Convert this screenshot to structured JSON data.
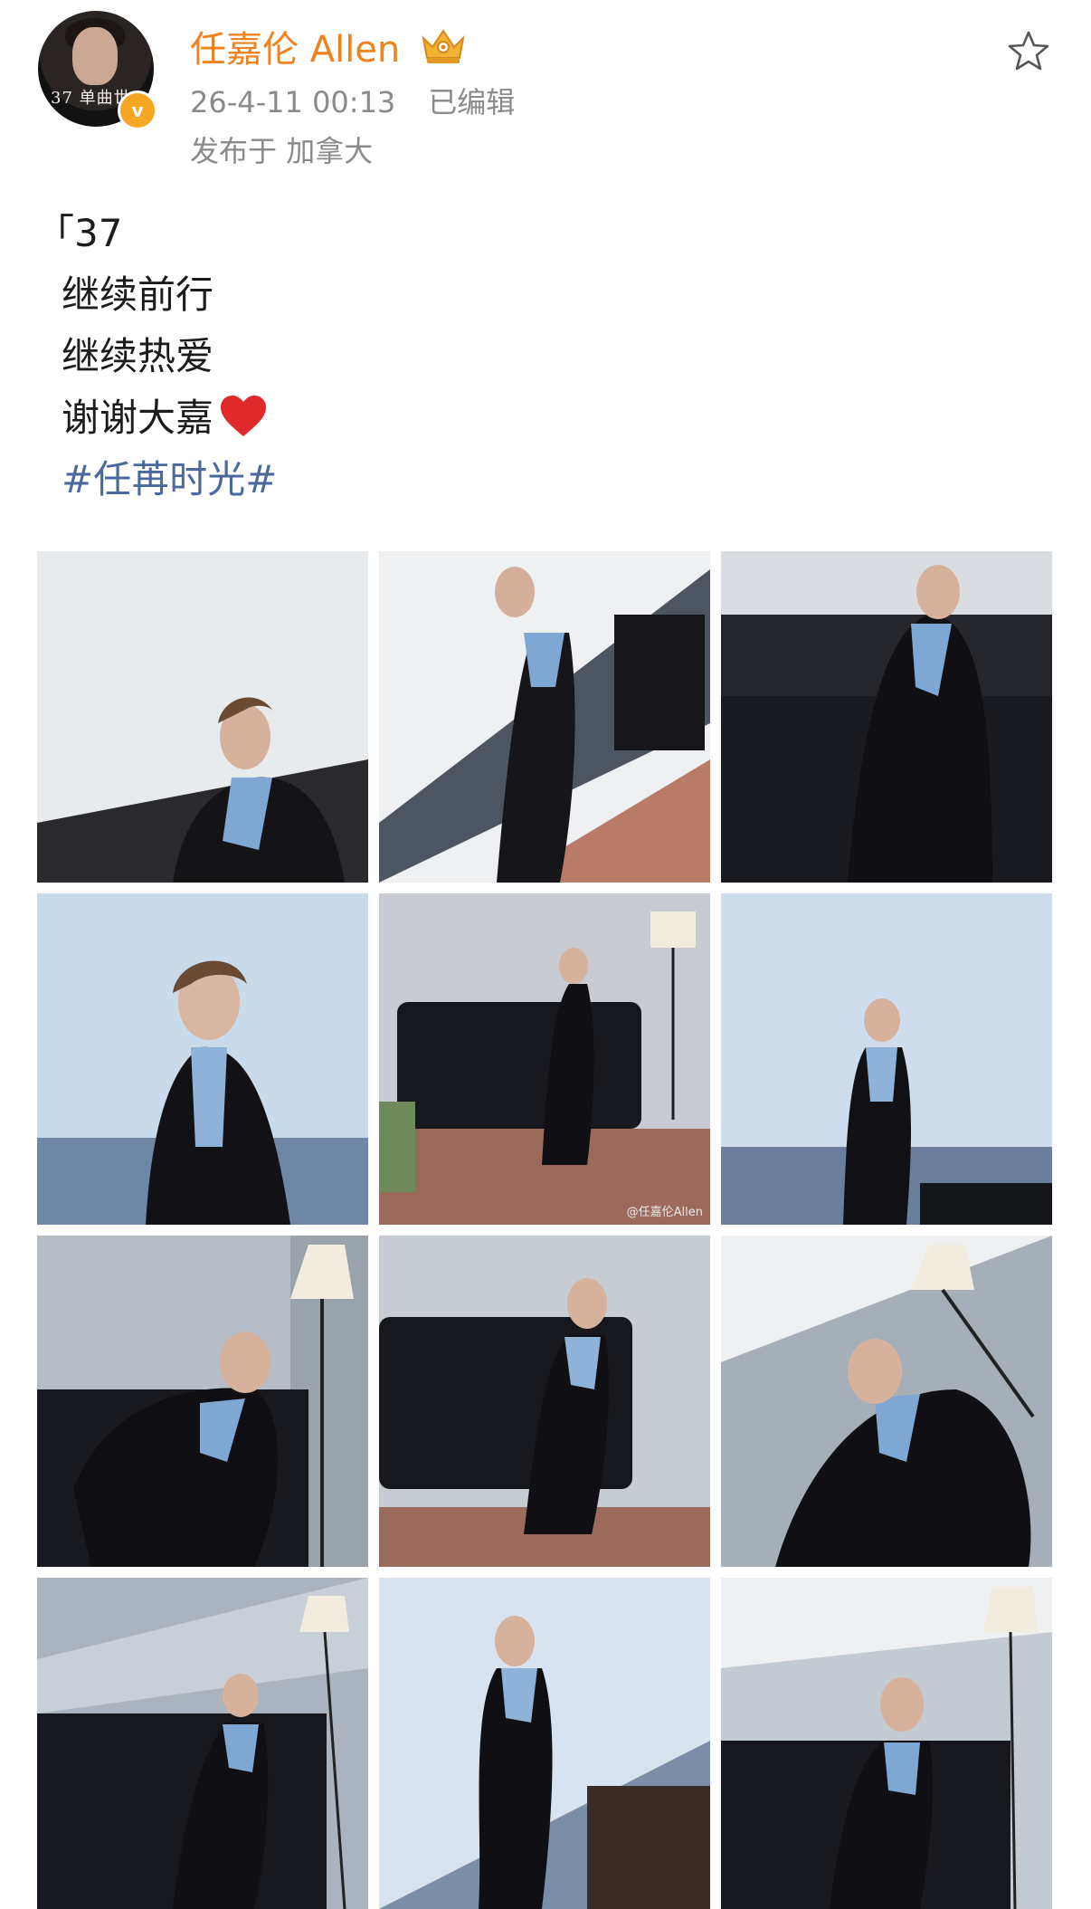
{
  "header": {
    "avatar_caption": "37 单曲世",
    "verified_mark": "v",
    "username": "任嘉伦 Allen",
    "timestamp": "26-4-11 00:13",
    "edited_label": "已编辑",
    "location_prefix": "发布于",
    "location": "加拿大"
  },
  "post": {
    "lines": [
      "「37",
      "继续前行",
      "继续热爱",
      "谢谢大嘉"
    ],
    "hashtag": "#任苒时光#"
  },
  "colors": {
    "username": "#f0821e",
    "hashtag": "#4a6a9e",
    "meta": "#8a8a8a",
    "verified_badge": "#f5a623",
    "heart": "#e02a2a"
  },
  "photos": [
    {
      "name": "photo-1"
    },
    {
      "name": "photo-2"
    },
    {
      "name": "photo-3"
    },
    {
      "name": "photo-4"
    },
    {
      "name": "photo-5",
      "watermark": "@任嘉伦Allen"
    },
    {
      "name": "photo-6"
    },
    {
      "name": "photo-7"
    },
    {
      "name": "photo-8"
    },
    {
      "name": "photo-9"
    },
    {
      "name": "photo-10"
    },
    {
      "name": "photo-11"
    },
    {
      "name": "photo-12"
    }
  ]
}
